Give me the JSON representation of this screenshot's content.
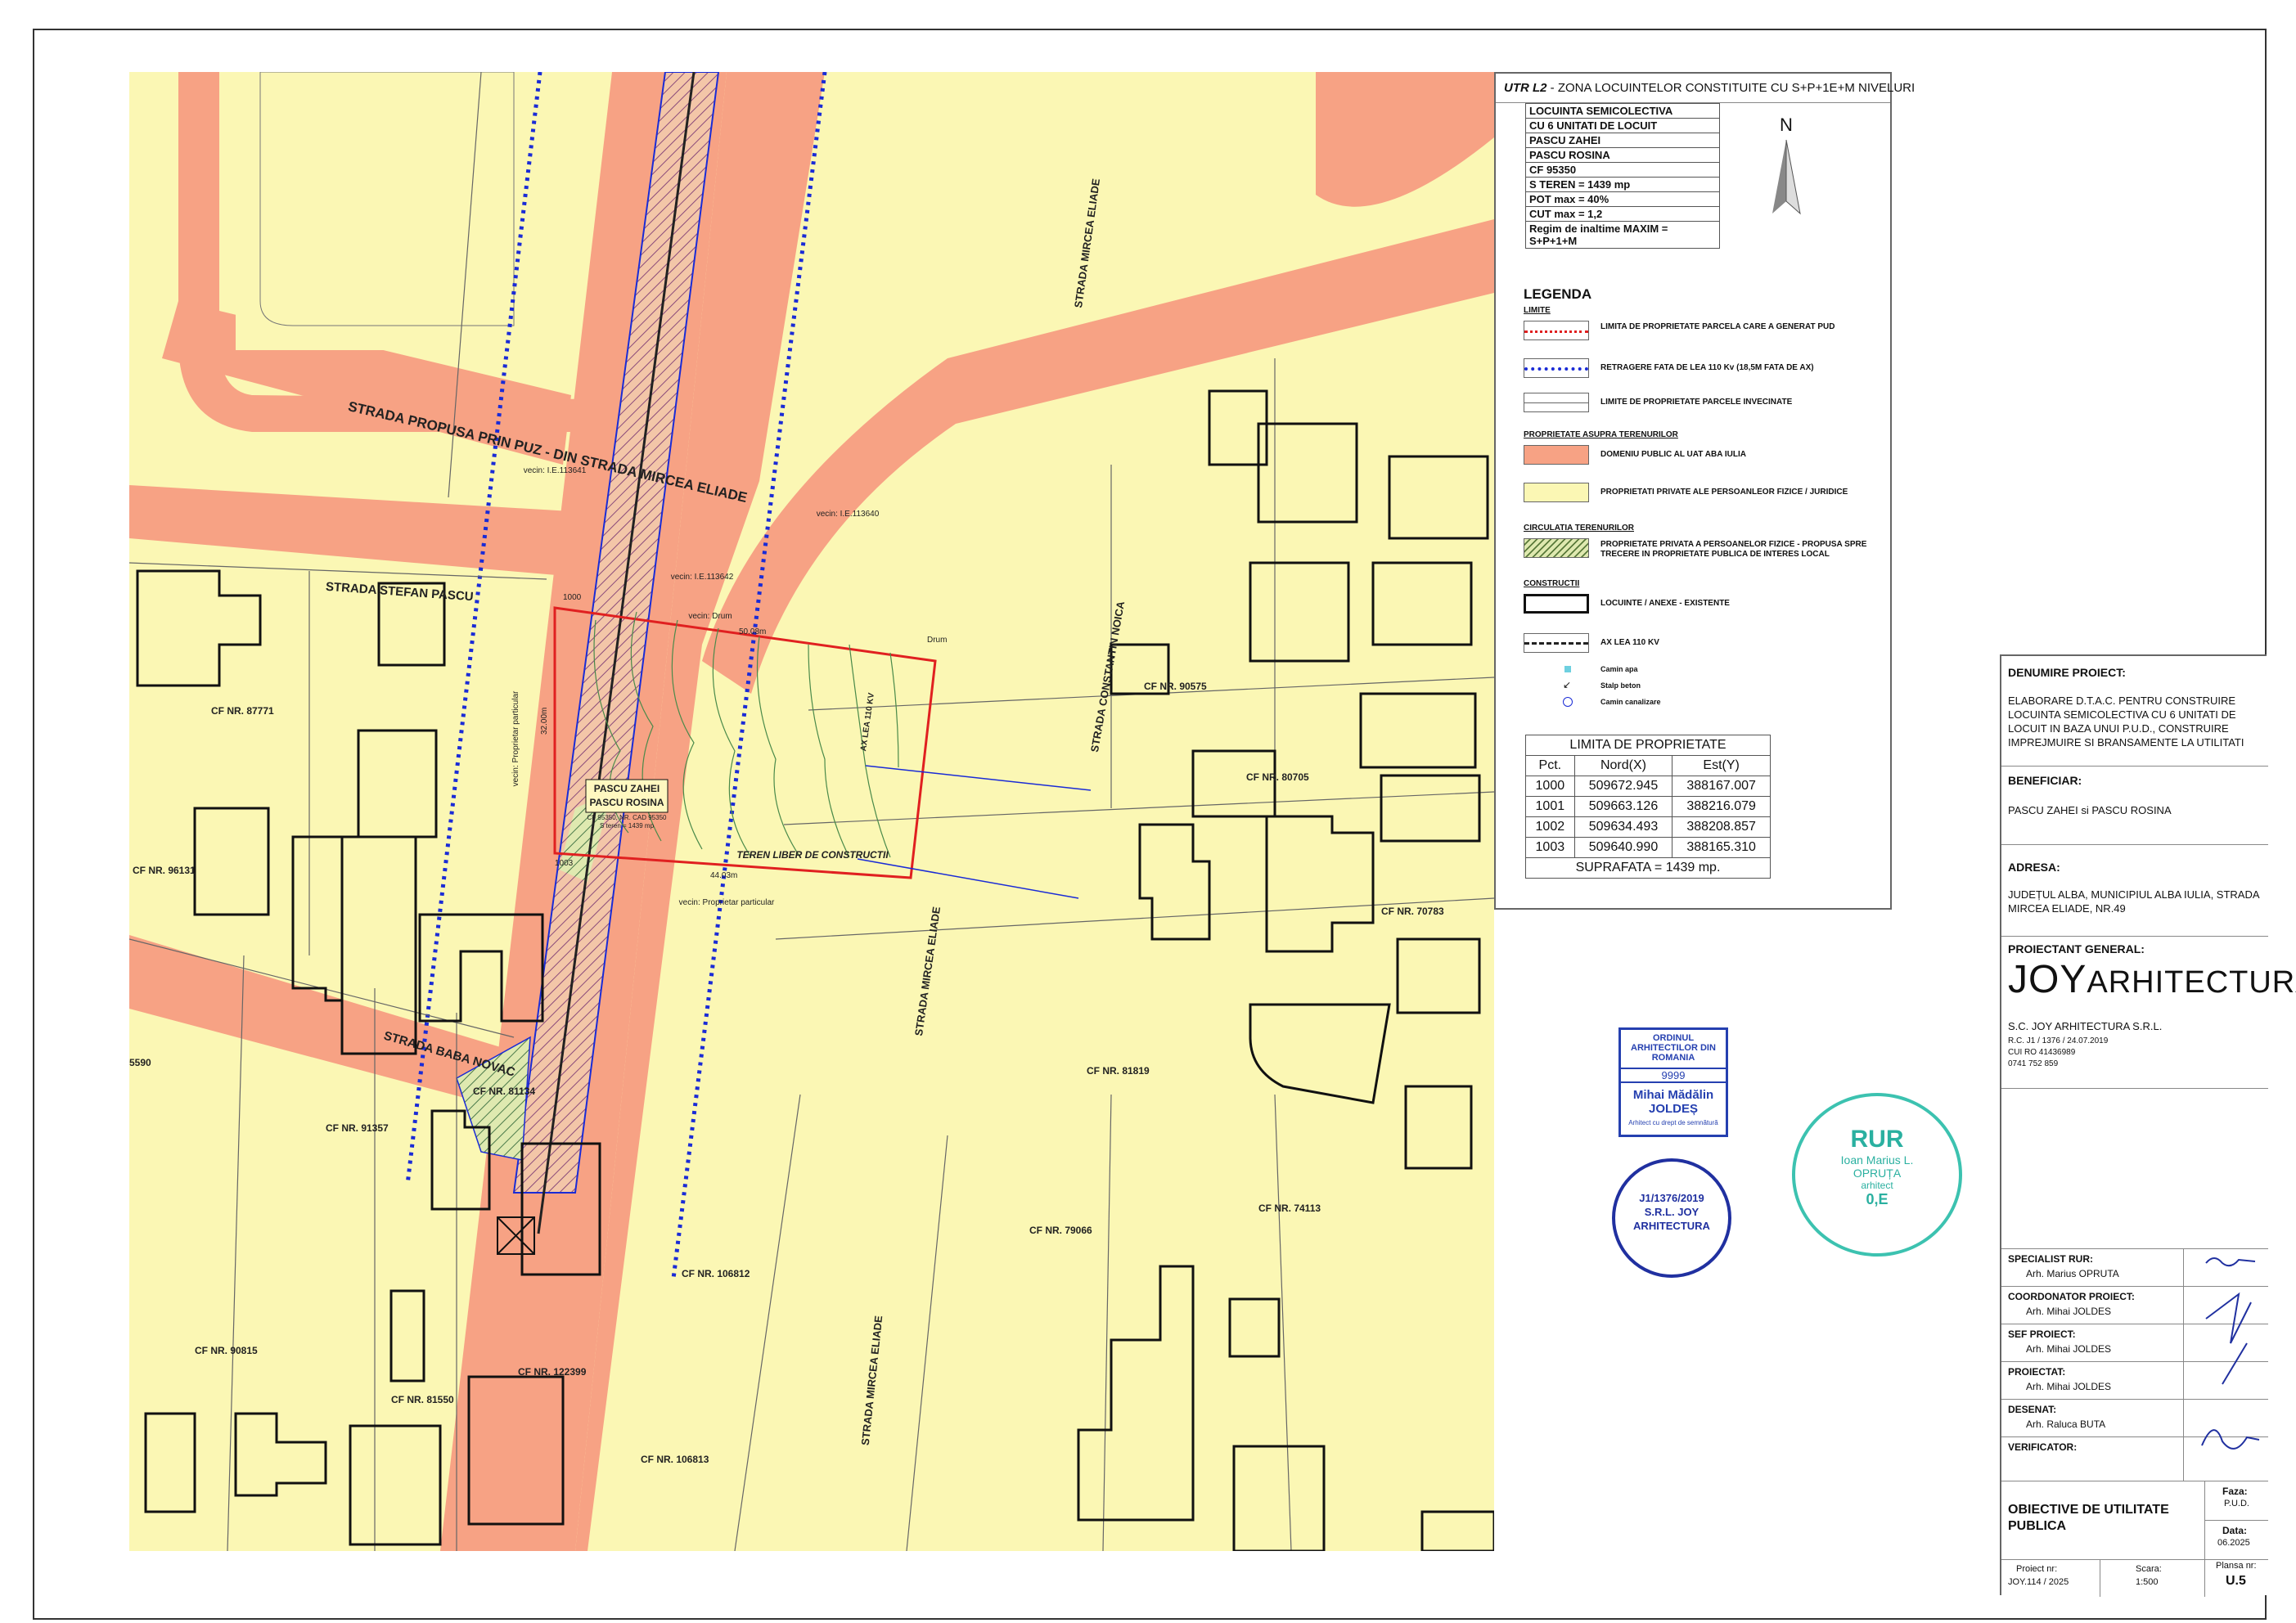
{
  "utr": {
    "code": "UTR L2",
    "text": " - ZONA LOCUINTELOR CONSTITUITE CU S+P+1E+M NIVELURI"
  },
  "project_params": [
    "LOCUINTA SEMICOLECTIVA",
    "CU 6 UNITATI DE LOCUIT",
    "PASCU ZAHEI",
    "PASCU ROSINA",
    "CF 95350",
    "S TEREN = 1439 mp",
    "POT max = 40%",
    "CUT max = 1,2",
    "Regim de inaltime MAXIM = S+P+1+M"
  ],
  "north": "N",
  "legend": {
    "title": "LEGENDA",
    "sections": {
      "limite": "LIMITE",
      "proprietate": "PROPRIETATE ASUPRA TERENURILOR",
      "circulatia": "CIRCULATIA TERENURILOR",
      "constructii": "CONSTRUCTII"
    },
    "items": {
      "limita": "LIMITA DE PROPRIETATE PARCELA CARE A GENERAT PUD",
      "retragere": "RETRAGERE FATA DE LEA 110 Kv (18,5M FATA DE AX)",
      "limite_invec": "LIMITE DE PROPRIETATE PARCELE INVECINATE",
      "domeniu": "DOMENIU PUBLIC AL UAT ABA IULIA",
      "private": "PROPRIETATI PRIVATE ALE PERSOANLEOR FIZICE / JURIDICE",
      "trecere": "PROPRIETATE PRIVATA A PERSOANELOR FIZICE - PROPUSA SPRE TRECERE IN PROPRIETATE PUBLICA DE INTERES LOCAL",
      "locuinte": "LOCUINTE / ANEXE - EXISTENTE",
      "ax": "AX LEA 110 KV",
      "camin_apa": "Camin apa",
      "stalp": "Stalp beton",
      "canal": "Camin canalizare"
    },
    "colors": {
      "public": "#f7a284",
      "private": "#fbf7b4",
      "red": "#e02020",
      "blue": "#1a2bd6"
    }
  },
  "coords": {
    "title": "LIMITA DE PROPRIETATE",
    "headers": [
      "Pct.",
      "Nord(X)",
      "Est(Y)"
    ],
    "rows": [
      [
        "1000",
        "509672.945",
        "388167.007"
      ],
      [
        "1001",
        "509663.126",
        "388216.079"
      ],
      [
        "1002",
        "509634.493",
        "388208.857"
      ],
      [
        "1003",
        "509640.990",
        "388165.310"
      ]
    ],
    "total": "SUPRAFATA = 1439 mp."
  },
  "map": {
    "streets": {
      "propusa": "STRADA PROPUSA PRIN PUZ - DIN STRADA MIRCEA ELIADE",
      "stefan": "STRADA STEFAN PASCU",
      "baba": "STRADA BABA NOVAC",
      "mircea1": "STRADA MIRCEA ELIADE",
      "mircea2": "STRADA MIRCEA ELIADE",
      "mircea3": "STRADA MIRCEA ELIADE",
      "noica": "STRADA CONSTANTIN NOICA"
    },
    "cf": {
      "cf87771": "CF NR. 87771",
      "cf96131": "CF NR. 96131",
      "cf90575": "CF NR. 90575",
      "cf80705": "CF NR. 80705",
      "cf70783": "CF NR. 70783",
      "cf81819": "CF NR. 81819",
      "cf81134": "CF NR. 81134",
      "cf91357": "CF NR. 91357",
      "cf79066": "CF NR. 79066",
      "cf74113": "CF NR. 74113",
      "cf106812": "CF NR. 106812",
      "cf90815": "CF NR. 90815",
      "cf122399": "CF NR. 122399",
      "cf81550": "CF NR. 81550",
      "cf106813": "CF NR. 106813",
      "cf5590": "5590"
    },
    "vecin": {
      "v113641": "vecin: I.E.113641",
      "v113640": "vecin: I.E.113640",
      "v113642": "vecin: I.E.113642",
      "drum": "vecin: Drum",
      "part1": "vecin: Proprietar particular",
      "part2": "vecin: Proprietar particular"
    },
    "parcel": {
      "name1": "PASCU ZAHEI",
      "name2": "PASCU ROSINA",
      "sub": "CF 95350, NR. CAD 95350",
      "area": "S teren = 1439 mp"
    },
    "teren": "TEREN LIBER DE CONSTRUCTII",
    "lea": "AX LEA 110 KV",
    "points": {
      "p1000": "1000",
      "p1003": "1003"
    },
    "dims": {
      "d1": "32.00m",
      "d2": "44.03m",
      "d3": "50.08m"
    },
    "drum": "Drum"
  },
  "stamps": {
    "oar_top": "ORDINUL ARHITECTILOR DIN ROMANIA",
    "oar_num": "9999",
    "oar_name": "Mihai Mădălin JOLDEȘ",
    "oar_sub": "Arhitect cu drept de semnătură",
    "joy_text": "J1/1376/2019 S.R.L. JOY ARHITECTURA",
    "rur_big": "RUR",
    "rur_name": "Ioan Marius L. OPRUȚA",
    "rur_sub": "arhitect",
    "rur_cat": "0,E"
  },
  "project": {
    "den_h": "DENUMIRE PROIECT:",
    "den": "ELABORARE D.T.A.C. PENTRU CONSTRUIRE LOCUINTA SEMICOLECTIVA CU 6 UNITATI DE LOCUIT IN BAZA UNUI P.U.D., CONSTRUIRE IMPREJMUIRE SI BRANSAMENTE LA UTILITATI",
    "ben_h": "BENEFICIAR:",
    "ben": "PASCU ZAHEI  si  PASCU ROSINA",
    "adr_h": "ADRESA:",
    "adr": "JUDEȚUL ALBA, MUNICIPIUL ALBA IULIA, STRADA MIRCEA ELIADE, NR.49",
    "pg_h": "PROIECTANT GENERAL:",
    "logo1": "JOY",
    "logo2": "ARHITECTURA",
    "company": "S.C. JOY ARHITECTURA S.R.L.",
    "rc": "R.C.  J1 / 1376 / 24.07.2019",
    "cui": "CUI RO 41436989",
    "tel": "0741 752 859",
    "roles": [
      {
        "role": "SPECIALIST RUR:",
        "name": "Arh. Marius OPRUTA"
      },
      {
        "role": "COORDONATOR PROIECT:",
        "name": "Arh. Mihai JOLDES"
      },
      {
        "role": "SEF PROIECT:",
        "name": "Arh. Mihai JOLDES"
      },
      {
        "role": "PROIECTAT:",
        "name": "Arh. Mihai JOLDES"
      },
      {
        "role": "DESENAT:",
        "name": "Arh. Raluca  BUTA"
      },
      {
        "role": "VERIFICATOR:",
        "name": ""
      }
    ],
    "plan_title": "OBIECTIVE DE UTILITATE PUBLICA",
    "faza_h": "Faza:",
    "faza": "P.U.D.",
    "data_h": "Data:",
    "data": "06.2025",
    "proiect_h": "Proiect  nr:",
    "proiect": "JOY.114 / 2025",
    "scara_h": "Scara:",
    "scara": "1:500",
    "plansa_h": "Plansa nr:",
    "plansa": "U.5"
  }
}
